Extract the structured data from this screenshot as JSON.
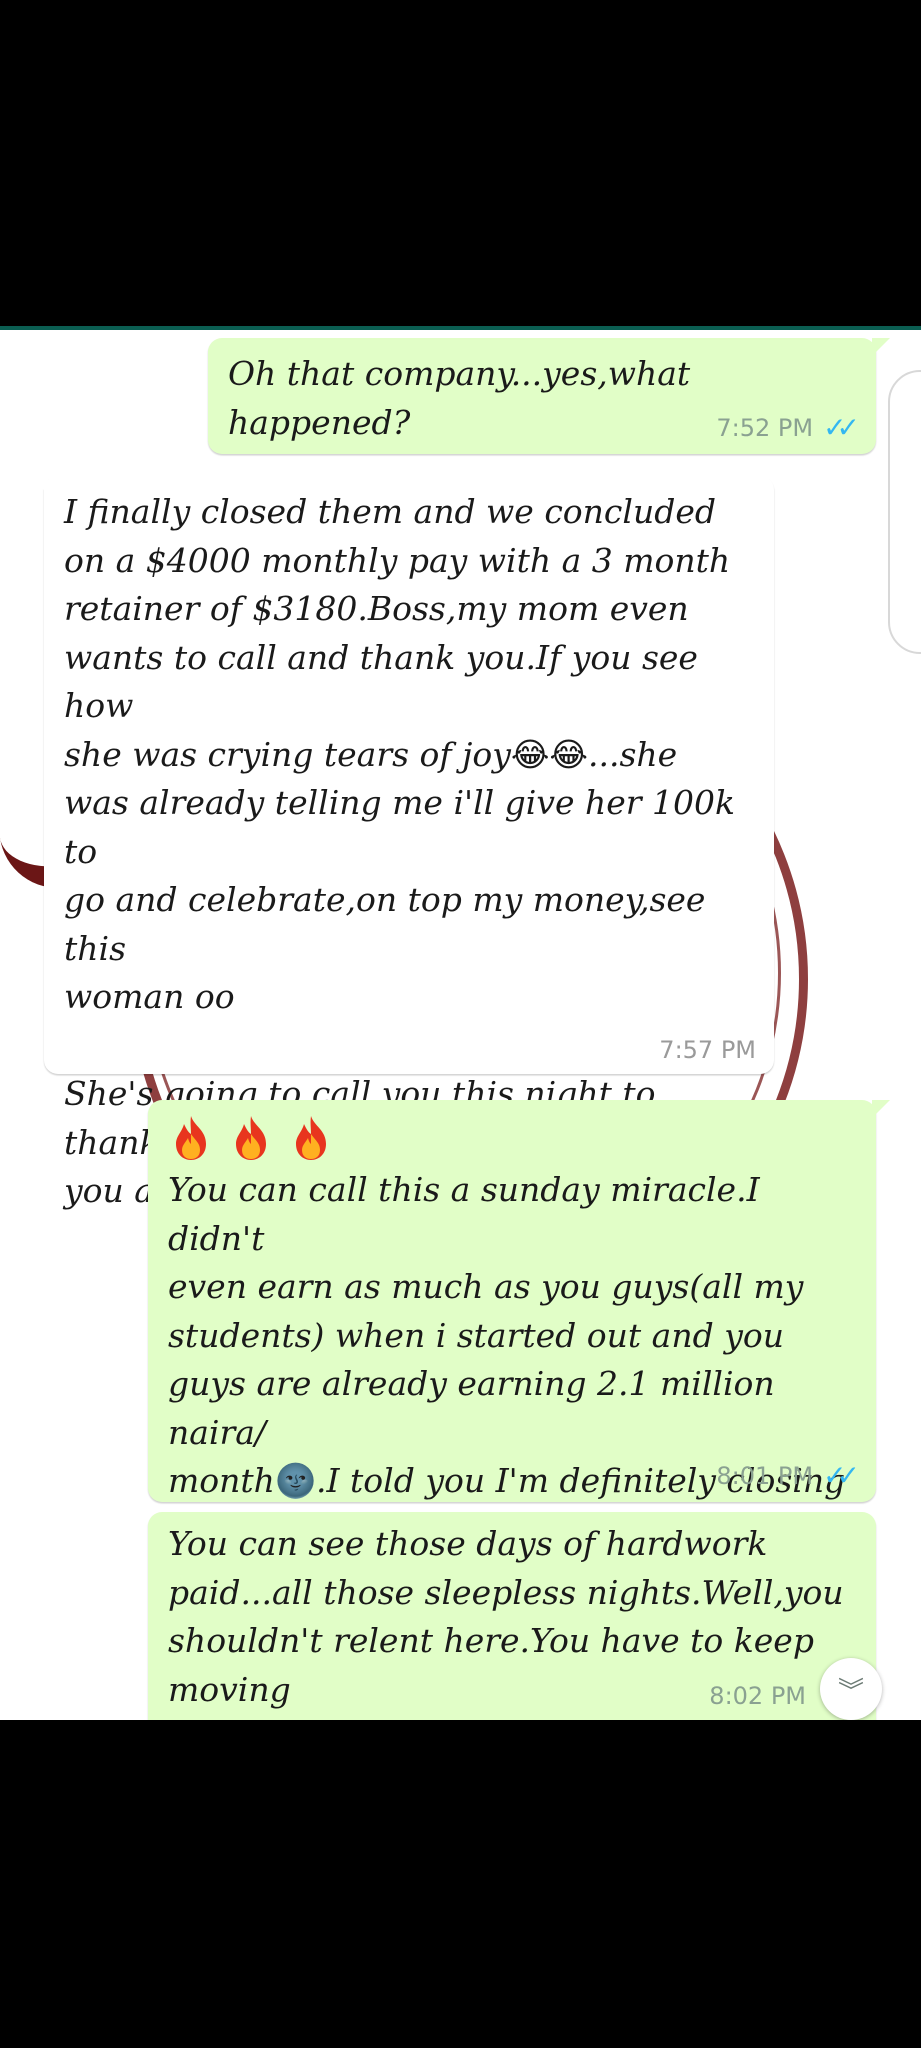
{
  "colors": {
    "outgoing_bubble": "#e1fec7",
    "incoming_bubble": "#ffffff",
    "read_ticks": "#34b7f1",
    "watermark": "#7a1d1d"
  },
  "messages": [
    {
      "direction": "outgoing",
      "text": "Oh that company...yes,what happened?",
      "time": "7:52 PM",
      "status": "read-ticks-icon"
    },
    {
      "direction": "incoming",
      "text_part1": "I finally closed them and we concluded\non a $4000 monthly pay with a 3 month\nretainer of $3180.Boss,my mom even\nwants to call and thank you.If you see how\nshe was crying tears of joy",
      "emoji_1": "😂😂",
      "text_part2": "...she\nwas already telling me i'll give her 100k to\ngo and celebrate,on top my money,see this\nwoman oo\n\nShe's going to call you this night to thank\nyou and pray for you!",
      "emoji_2": "😂",
      "time": "7:57 PM"
    },
    {
      "direction": "outgoing",
      "icons": [
        "fire-icon",
        "fire-icon",
        "fire-icon"
      ],
      "text_part1": "You can call this a sunday miracle.I didn't\neven earn as much as you guys(all my\nstudents) when i started out and you\nguys are already earning 2.1 million naira/\nmonth",
      "emoji_1": "🌚",
      "text_part2": ".I told you I'm definitely closing\nthe program in some days right?",
      "time": "8:01 PM",
      "status": "read-ticks-icon"
    },
    {
      "direction": "outgoing",
      "text": "You can see those days of hardwork\npaid...all those sleepless nights.Well,you\nshouldn't relent here.You have to keep\nmoving",
      "time": "8:02 PM"
    }
  ],
  "scroll_button": {
    "icon": "double-chevron-down-icon",
    "glyph": "︾"
  }
}
